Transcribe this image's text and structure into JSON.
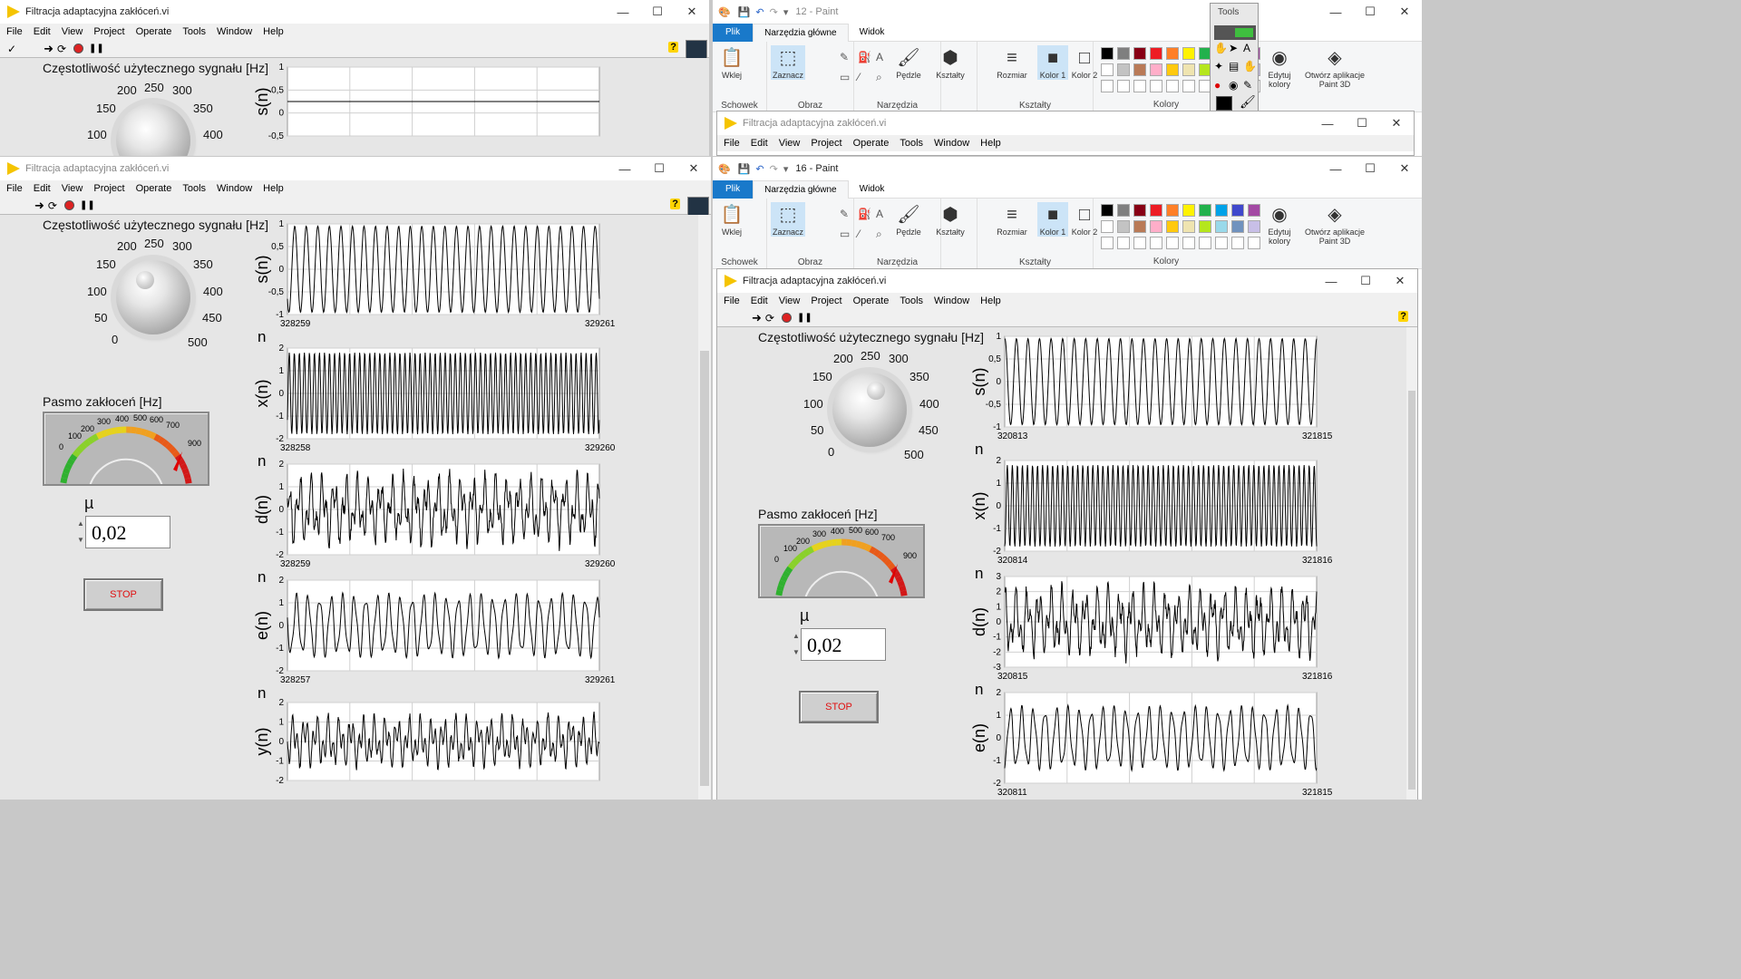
{
  "lv_title": "Filtracja adaptacyjna zakłóceń.vi",
  "menu": [
    "File",
    "Edit",
    "View",
    "Project",
    "Operate",
    "Tools",
    "Window",
    "Help"
  ],
  "help_glyph": "?",
  "freq_label": "Częstotliwość użytecznego sygnału [Hz]",
  "knob_ticks": [
    "0",
    "50",
    "100",
    "150",
    "200",
    "250",
    "300",
    "350",
    "400",
    "450",
    "500"
  ],
  "noise_label": "Pasmo zakłoceń [Hz]",
  "gauge_ticks": [
    "0",
    "100",
    "200",
    "300",
    "400",
    "500",
    "600",
    "700",
    "900"
  ],
  "mu_label": "µ",
  "mu_value": "0,02",
  "stop_label": "STOP",
  "n_label": "n",
  "window_buttons": {
    "min": "—",
    "max": "☐",
    "close": "✕"
  },
  "top_left": {
    "chart_label": "s(n)",
    "y_ticks": [
      "1",
      "0,5",
      "0",
      "-0,5"
    ]
  },
  "left_charts": [
    {
      "label": "s(n)",
      "y_ticks": [
        "1",
        "0,5",
        "0",
        "-0,5",
        "-1"
      ],
      "x_start": "328259",
      "x_end": "329261"
    },
    {
      "label": "x(n)",
      "y_ticks": [
        "2",
        "1",
        "0",
        "-1",
        "-2"
      ],
      "x_start": "328258",
      "x_end": "329260"
    },
    {
      "label": "d(n)",
      "y_ticks": [
        "2",
        "1",
        "0",
        "-1",
        "-2"
      ],
      "x_start": "328259",
      "x_end": "329260"
    },
    {
      "label": "e(n)",
      "y_ticks": [
        "2",
        "1",
        "0",
        "-1",
        "-2"
      ],
      "x_start": "328257",
      "x_end": "329261"
    },
    {
      "label": "y(n)",
      "y_ticks": [
        "2",
        "1",
        "0",
        "-1",
        "-2"
      ],
      "x_start": "",
      "x_end": ""
    }
  ],
  "right_charts": [
    {
      "label": "s(n)",
      "y_ticks": [
        "1",
        "0,5",
        "0",
        "-0,5",
        "-1"
      ],
      "x_start": "320813",
      "x_end": "321815"
    },
    {
      "label": "x(n)",
      "y_ticks": [
        "2",
        "1",
        "0",
        "-1",
        "-2"
      ],
      "x_start": "320814",
      "x_end": "321816"
    },
    {
      "label": "d(n)",
      "y_ticks": [
        "3",
        "2",
        "1",
        "0",
        "-1",
        "-2",
        "-3"
      ],
      "x_start": "320815",
      "x_end": "321816"
    },
    {
      "label": "e(n)",
      "y_ticks": [
        "2",
        "1",
        "0",
        "-1",
        "-2"
      ],
      "x_start": "320811",
      "x_end": "321815"
    }
  ],
  "paint": {
    "title_top": "12 - Paint",
    "title_bottom": "16 - Paint",
    "tab_plik": "Plik",
    "tab_home": "Narzędzia główne",
    "tab_view": "Widok",
    "btn_paste": "Wklej",
    "btn_select": "Zaznacz",
    "btn_brushes": "Pędzle",
    "btn_shapes": "Kształty",
    "btn_size": "Rozmiar",
    "btn_color1": "Kolor 1",
    "btn_color2": "Kolor 2",
    "btn_edit_colors": "Edytuj kolory",
    "btn_paint3d": "Otwórz aplikacje Paint 3D",
    "grp_clipboard": "Schowek",
    "grp_image": "Obraz",
    "grp_tools": "Narzędzia",
    "grp_shapes": "Kształty",
    "grp_colors": "Kolory",
    "palette_row1": [
      "#000000",
      "#7f7f7f",
      "#880015",
      "#ed1c24",
      "#ff7f27",
      "#fff200",
      "#22b14c",
      "#00a2e8",
      "#3f48cc",
      "#a349a4"
    ],
    "palette_row2": [
      "#ffffff",
      "#c3c3c3",
      "#b97a57",
      "#ffaec9",
      "#ffc90e",
      "#efe4b0",
      "#b5e61d",
      "#99d9ea",
      "#7092be",
      "#c8bfe7"
    ],
    "tools_palette_title": "Tools"
  },
  "signal_colors": {
    "trace": "#000000",
    "grid": "#d0d0d0",
    "plot_bg": "#ffffff",
    "gauge_needle": "#e00000"
  }
}
